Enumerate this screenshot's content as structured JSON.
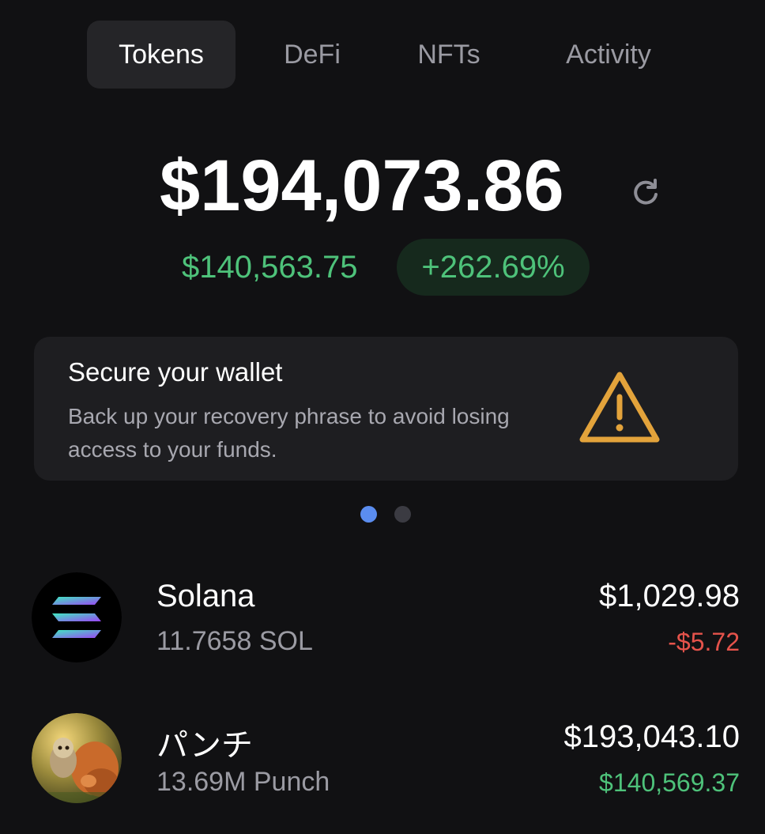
{
  "tabs": [
    {
      "label": "Tokens",
      "active": true
    },
    {
      "label": "DeFi",
      "active": false
    },
    {
      "label": "NFTs",
      "active": false
    },
    {
      "label": "Activity",
      "active": false
    }
  ],
  "balance": {
    "total": "$194,073.86",
    "change_amount": "$140,563.75",
    "change_percent": "+262.69%",
    "refresh_icon": "refresh-icon"
  },
  "banner": {
    "title": "Secure your wallet",
    "body": "Back up your recovery phrase to avoid losing access to your funds.",
    "icon": "warning-icon",
    "page": 1,
    "pages": 2
  },
  "tokens": [
    {
      "name": "Solana",
      "amount": "11.7658 SOL",
      "value": "$1,029.98",
      "change": "-$5.72",
      "change_direction": "down"
    },
    {
      "name": "パンチ",
      "amount": "13.69M Punch",
      "value": "$193,043.10",
      "change": "$140,569.37",
      "change_direction": "up"
    }
  ],
  "colors": {
    "background": "#111113",
    "positive": "#4ec27a",
    "negative": "#e5534b",
    "warning": "#e3a33b",
    "accent_dot": "#5b8def"
  }
}
